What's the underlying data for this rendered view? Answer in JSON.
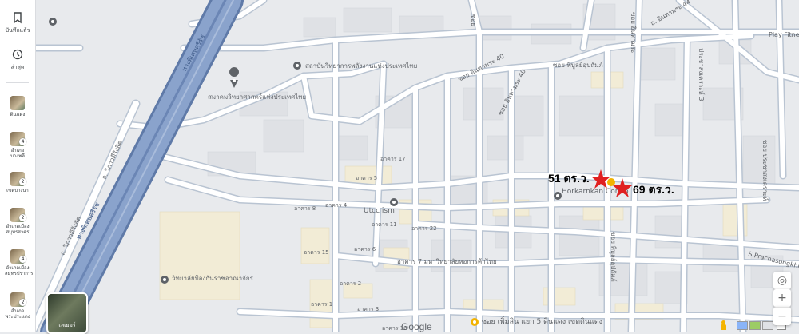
{
  "sidebar": {
    "saved_label": "บันทึกแล้ว",
    "recents_label": "ล่าสุด",
    "recent_items": [
      {
        "label": "ดินแดง",
        "count": ""
      },
      {
        "label": "อำเภอบางพลี",
        "count": "4"
      },
      {
        "label": "เขตบางนา",
        "count": "2"
      },
      {
        "label": "อำเภอเมืองสมุทรสาคร",
        "count": "2"
      },
      {
        "label": "อำเภอเมืองสมุทรปราการ",
        "count": "4"
      },
      {
        "label": "อำเภอพระประแดง",
        "count": "2"
      }
    ]
  },
  "layers": {
    "label": "เลเยอร์"
  },
  "places": {
    "science_society": "สมาคมวิทยาศาสตร์แห่งประเทศไทย",
    "engineering_institute": "สถาบันวิทยาการพลังงานแห่งประเทศไทย",
    "horkarnkan": "Horkarnkan Condo",
    "utcc": "Utcc ism",
    "college": "วิทยาลัยป้องกันราชอาณาจักร",
    "utcc_building7": "อาคาร 7 มหาวิทยาลัยหอการค้าไทย",
    "play_fitness": "Play Fitne",
    "bottom_place": "ซอย เพิ่มสิน แยก 5 ดินแดง เขตดินแดง"
  },
  "roads": {
    "expressway": "ทางพิเศษศรีรัช",
    "vibhavadi_1": "ถ. วิภาวดีรังสิต",
    "vibhavadi_2": "ถ. วิภาวดีรังสิต",
    "expressway_2": "ทางพิเศษศรีรัช",
    "inthamara_40": "ซอย อินทามระ 40",
    "inthamara_40b": "ซอย อินทามระ 40",
    "inthamara_44": "ถ. อินทามระ 44",
    "soi_phiboon": "ซอย พิบูลย์อุปถัมภ์",
    "soi_top": "ซอย",
    "s_prachasongkhro": "S Prachasongkhro",
    "vertical_right": "ซอย ประชาสงเคราะห์",
    "vertical_mid": "ซอย พิบูลย์อุปถัมภ์",
    "top_center": "ซอย อินทามระ",
    "road_right_v": "ประชาสงเคราะห์ 3"
  },
  "buildings": [
    "อาคาร 17",
    "อาคาร 5",
    "อาคาร 8",
    "อาคาร 4",
    "อาคาร 11",
    "อาคาร 22",
    "อาคาร 15",
    "อาคาร 6",
    "อาคาร 2",
    "อาคาร 1",
    "อาคาร 3",
    "อาคาร 10"
  ],
  "markers": {
    "marker_51": "51 ตร.ว.",
    "marker_69": "69 ตร.ว."
  },
  "brand": {
    "google": "Google"
  },
  "colors": {
    "marker": "#e02020",
    "road": "#ffffff",
    "road_outline": "#b9c4d2",
    "expressway": "#7f99c2",
    "land": "#e8eaed"
  },
  "icons": {
    "saved": "bookmark-icon",
    "recents": "history-icon",
    "locate": "my-location-icon",
    "zoom_in": "plus-icon",
    "zoom_out": "minus-icon",
    "pegman": "pegman-icon"
  }
}
